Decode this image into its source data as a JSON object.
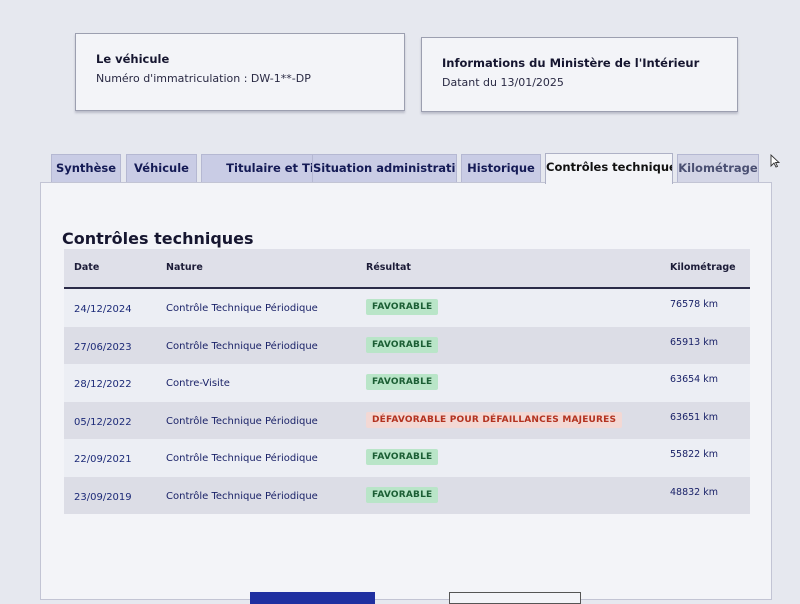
{
  "vehicle_card": {
    "title": "Le véhicule",
    "plate_text": "Numéro d'immatriculation : DW-1**-DP"
  },
  "ministry_card": {
    "title": "Informations du Ministère de l'Intérieur",
    "date_text": "Datant du 13/01/2025"
  },
  "tabs": [
    {
      "label": "Synthèse",
      "active": false
    },
    {
      "label": "Véhicule",
      "active": false
    },
    {
      "label": "Titulaire et Titre",
      "active": false
    },
    {
      "label": "Situation administrative",
      "active": false
    },
    {
      "label": "Historique",
      "active": false
    },
    {
      "label": "Contrôles techniques",
      "active": true
    },
    {
      "label": "Kilométrage",
      "active": false
    }
  ],
  "section": {
    "title": "Contrôles techniques",
    "columns": [
      "Date",
      "Nature",
      "Résultat",
      "Kilométrage"
    ],
    "rows": [
      {
        "date": "24/12/2024",
        "nature": "Contrôle Technique Périodique",
        "result": "FAVORABLE",
        "result_status": "ok",
        "km": "76578 km"
      },
      {
        "date": "27/06/2023",
        "nature": "Contrôle Technique Périodique",
        "result": "FAVORABLE",
        "result_status": "ok",
        "km": "65913 km"
      },
      {
        "date": "28/12/2022",
        "nature": "Contre-Visite",
        "result": "FAVORABLE",
        "result_status": "ok",
        "km": "63654 km"
      },
      {
        "date": "05/12/2022",
        "nature": "Contrôle Technique Périodique",
        "result": "DÉFAVORABLE POUR DÉFAILLANCES MAJEURES",
        "result_status": "ko",
        "km": "63651 km"
      },
      {
        "date": "22/09/2021",
        "nature": "Contrôle Technique Périodique",
        "result": "FAVORABLE",
        "result_status": "ok",
        "km": "55822 km"
      },
      {
        "date": "23/09/2019",
        "nature": "Contrôle Technique Périodique",
        "result": "FAVORABLE",
        "result_status": "ok",
        "km": "48832 km"
      }
    ]
  },
  "colors": {
    "accent": "#1f2fa0",
    "tab_bg": "#c9cce5",
    "favorable_bg": "#b9e5c8",
    "favorable_text": "#1b5e34",
    "defavorable_bg": "#f3d8d4",
    "defavorable_text": "#b3321f"
  }
}
